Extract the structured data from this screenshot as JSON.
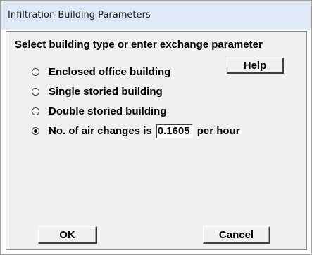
{
  "window": {
    "title": "Infiltration Building Parameters"
  },
  "prompt": "Select building type or enter exchange parameter",
  "options": [
    {
      "label": "Enclosed office building",
      "selected": false
    },
    {
      "label": "Single storied building",
      "selected": false
    },
    {
      "label": "Double storied building",
      "selected": false
    },
    {
      "label_prefix": "No. of air changes is",
      "value": "0.1605",
      "label_suffix": "per hour",
      "selected": true
    }
  ],
  "buttons": {
    "help": "Help",
    "ok": "OK",
    "cancel": "Cancel"
  },
  "colors": {
    "titlebar": "#dfe9f5",
    "client_background": "#f0f0f0"
  }
}
